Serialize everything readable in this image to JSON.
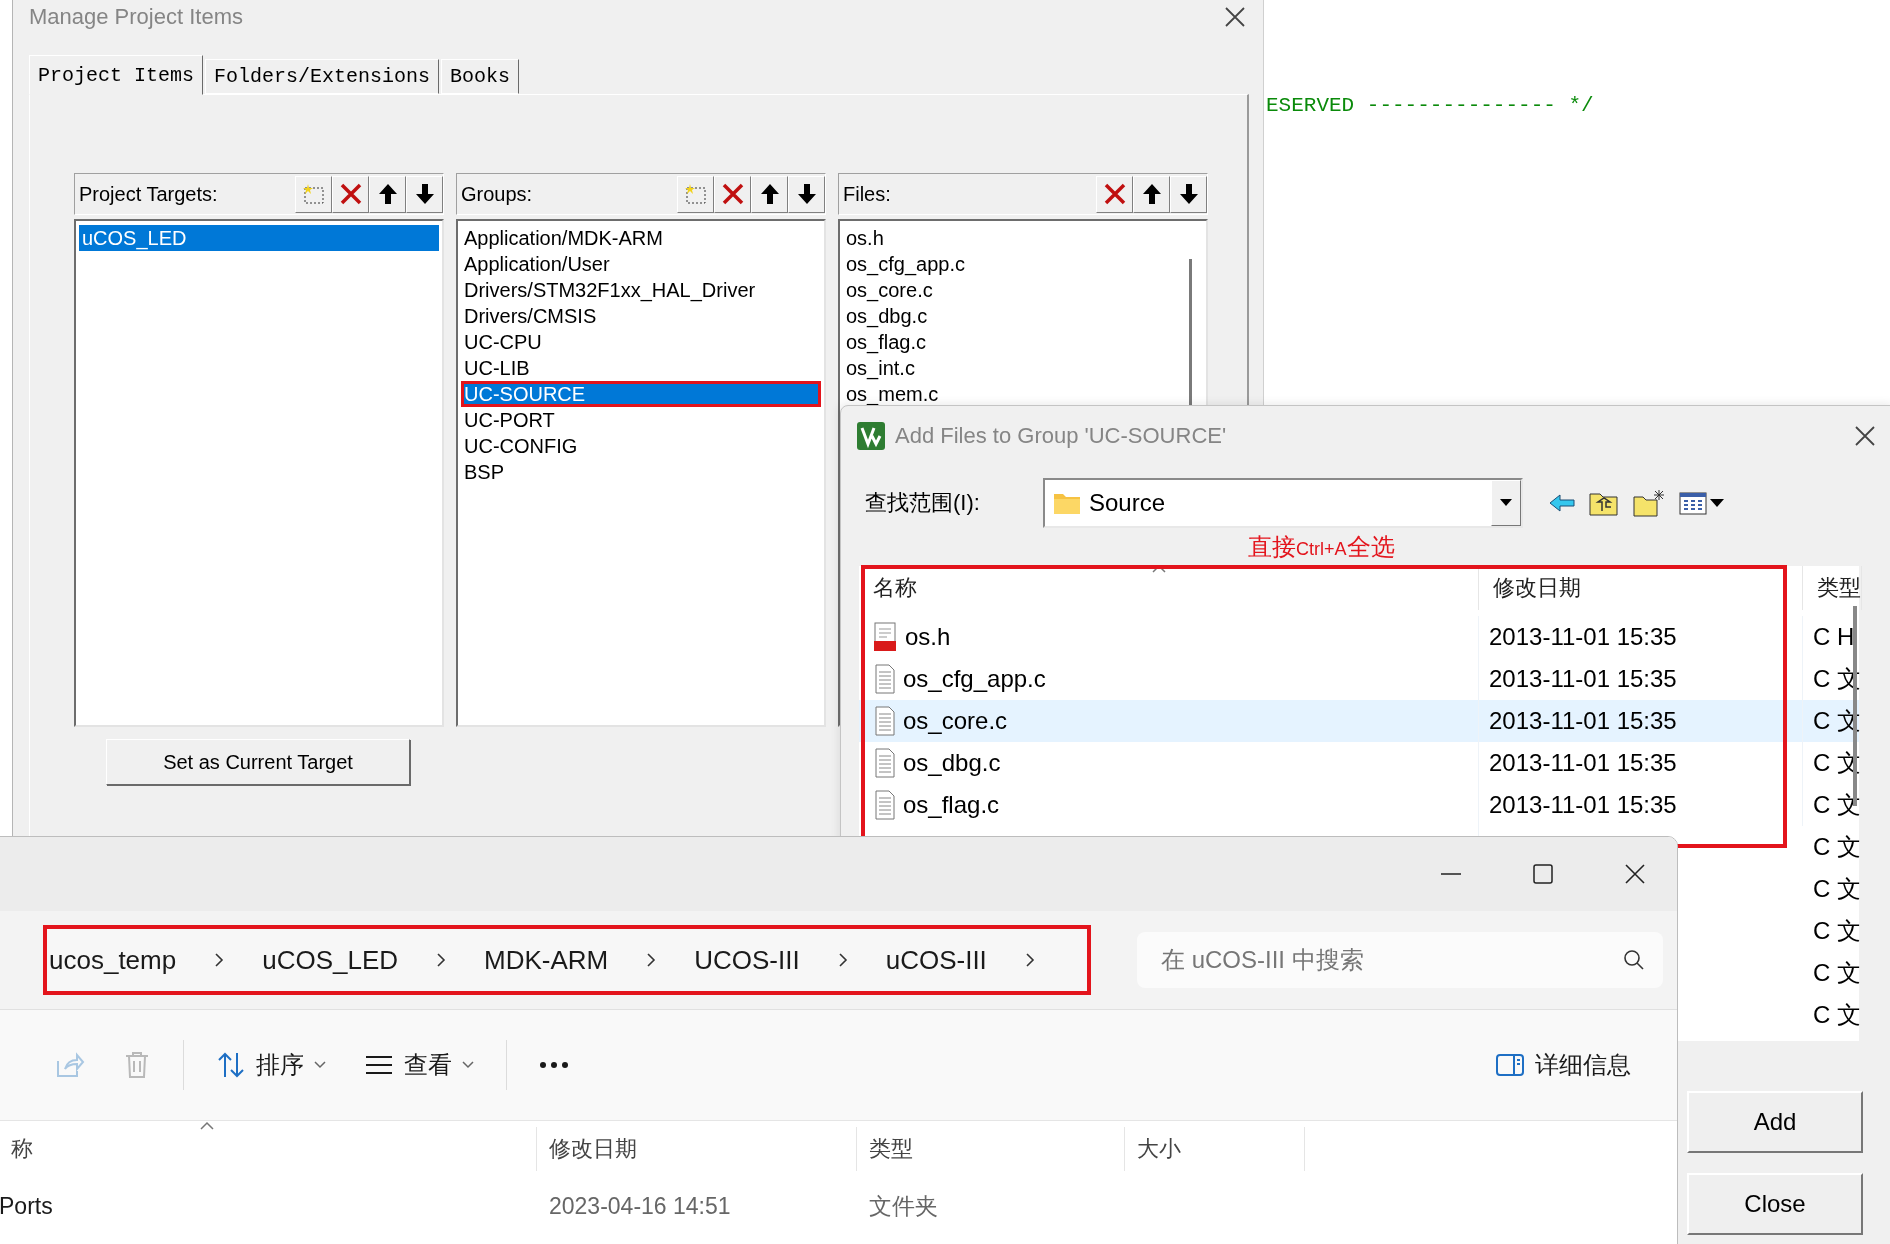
{
  "editor": {
    "code_text": "ESERVED --------------- */"
  },
  "manage_dialog": {
    "title": "Manage Project Items",
    "tabs": [
      {
        "label": "Project Items",
        "selected": true
      },
      {
        "label": "Folders/Extensions",
        "selected": false
      },
      {
        "label": "Books",
        "selected": false
      }
    ],
    "panels": [
      {
        "label": "Project Targets:",
        "scrollable": false,
        "tools": [
          {
            "kind": "new"
          },
          {
            "kind": "delete"
          },
          {
            "kind": "up"
          },
          {
            "kind": "down"
          }
        ],
        "items": [
          {
            "text": "uCOS_LED",
            "selected": true,
            "annotated": false
          }
        ]
      },
      {
        "label": "Groups:",
        "scrollable": false,
        "tools": [
          {
            "kind": "new"
          },
          {
            "kind": "delete"
          },
          {
            "kind": "up"
          },
          {
            "kind": "down"
          }
        ],
        "items": [
          {
            "text": "Application/MDK-ARM",
            "selected": false,
            "annotated": false
          },
          {
            "text": "Application/User",
            "selected": false,
            "annotated": false
          },
          {
            "text": "Drivers/STM32F1xx_HAL_Driver",
            "selected": false,
            "annotated": false
          },
          {
            "text": "Drivers/CMSIS",
            "selected": false,
            "annotated": false
          },
          {
            "text": "UC-CPU",
            "selected": false,
            "annotated": false
          },
          {
            "text": "UC-LIB",
            "selected": false,
            "annotated": false
          },
          {
            "text": "UC-SOURCE",
            "selected": true,
            "annotated": true
          },
          {
            "text": "UC-PORT",
            "selected": false,
            "annotated": false
          },
          {
            "text": "UC-CONFIG",
            "selected": false,
            "annotated": false
          },
          {
            "text": "BSP",
            "selected": false,
            "annotated": false
          }
        ]
      },
      {
        "label": "Files:",
        "scrollable": true,
        "tools": [
          {
            "kind": "delete"
          },
          {
            "kind": "up"
          },
          {
            "kind": "down"
          }
        ],
        "items": [
          {
            "text": "os.h",
            "selected": false,
            "annotated": false
          },
          {
            "text": "os_cfg_app.c",
            "selected": false,
            "annotated": false
          },
          {
            "text": "os_core.c",
            "selected": false,
            "annotated": false
          },
          {
            "text": "os_dbg.c",
            "selected": false,
            "annotated": false
          },
          {
            "text": "os_flag.c",
            "selected": false,
            "annotated": false
          },
          {
            "text": "os_int.c",
            "selected": false,
            "annotated": false
          },
          {
            "text": "os_mem.c",
            "selected": false,
            "annotated": false
          }
        ]
      }
    ],
    "set_target_button": "Set as Current Target"
  },
  "add_files_dialog": {
    "title": "Add Files to Group 'UC-SOURCE'",
    "look_in_label": "查找范围(I):",
    "look_in_value": "Source",
    "annotation_parts": [
      {
        "text": "直接",
        "kind": "large"
      },
      {
        "text": "Ctrl+A",
        "kind": "small"
      },
      {
        "text": "全选",
        "kind": "large"
      }
    ],
    "list_annotated": true,
    "columns": [
      "名称",
      "修改日期",
      "类型"
    ],
    "rows": [
      {
        "kind": "header_file",
        "name": "os.h",
        "modified": "2013-11-01 15:35",
        "type": "C H",
        "hover": false
      },
      {
        "kind": "c_file",
        "name": "os_cfg_app.c",
        "modified": "2013-11-01 15:35",
        "type": "C 文",
        "hover": false
      },
      {
        "kind": "c_file",
        "name": "os_core.c",
        "modified": "2013-11-01 15:35",
        "type": "C 文",
        "hover": true
      },
      {
        "kind": "c_file",
        "name": "os_dbg.c",
        "modified": "2013-11-01 15:35",
        "type": "C 文",
        "hover": false
      },
      {
        "kind": "c_file",
        "name": "os_flag.c",
        "modified": "2013-11-01 15:35",
        "type": "C 文",
        "hover": false
      },
      {
        "type": "C 文"
      },
      {
        "type": "C 文"
      },
      {
        "type": "C 文"
      },
      {
        "type": "C 文"
      },
      {
        "type": "C 文"
      }
    ],
    "buttons": [
      "Add",
      "Close"
    ]
  },
  "explorer": {
    "breadcrumb_annotated": true,
    "breadcrumb": [
      "ucos_temp",
      "uCOS_LED",
      "MDK-ARM",
      "UCOS-III",
      "uCOS-III"
    ],
    "search_placeholder": "在 uCOS-III 中搜索",
    "toolbar": [
      {
        "kind": "share",
        "disabled": true
      },
      {
        "kind": "delete",
        "disabled": true
      },
      {
        "kind": "divider"
      },
      {
        "kind": "sort",
        "label": "排序"
      },
      {
        "kind": "view",
        "label": "查看"
      },
      {
        "kind": "divider"
      },
      {
        "kind": "more"
      },
      {
        "kind": "details",
        "label": "详细信息"
      }
    ],
    "columns": [
      "称",
      "修改日期",
      "类型",
      "大小"
    ],
    "rows": [
      {
        "name": "Ports",
        "modified": "2023-04-16 14:51",
        "type": "文件夹"
      }
    ]
  }
}
